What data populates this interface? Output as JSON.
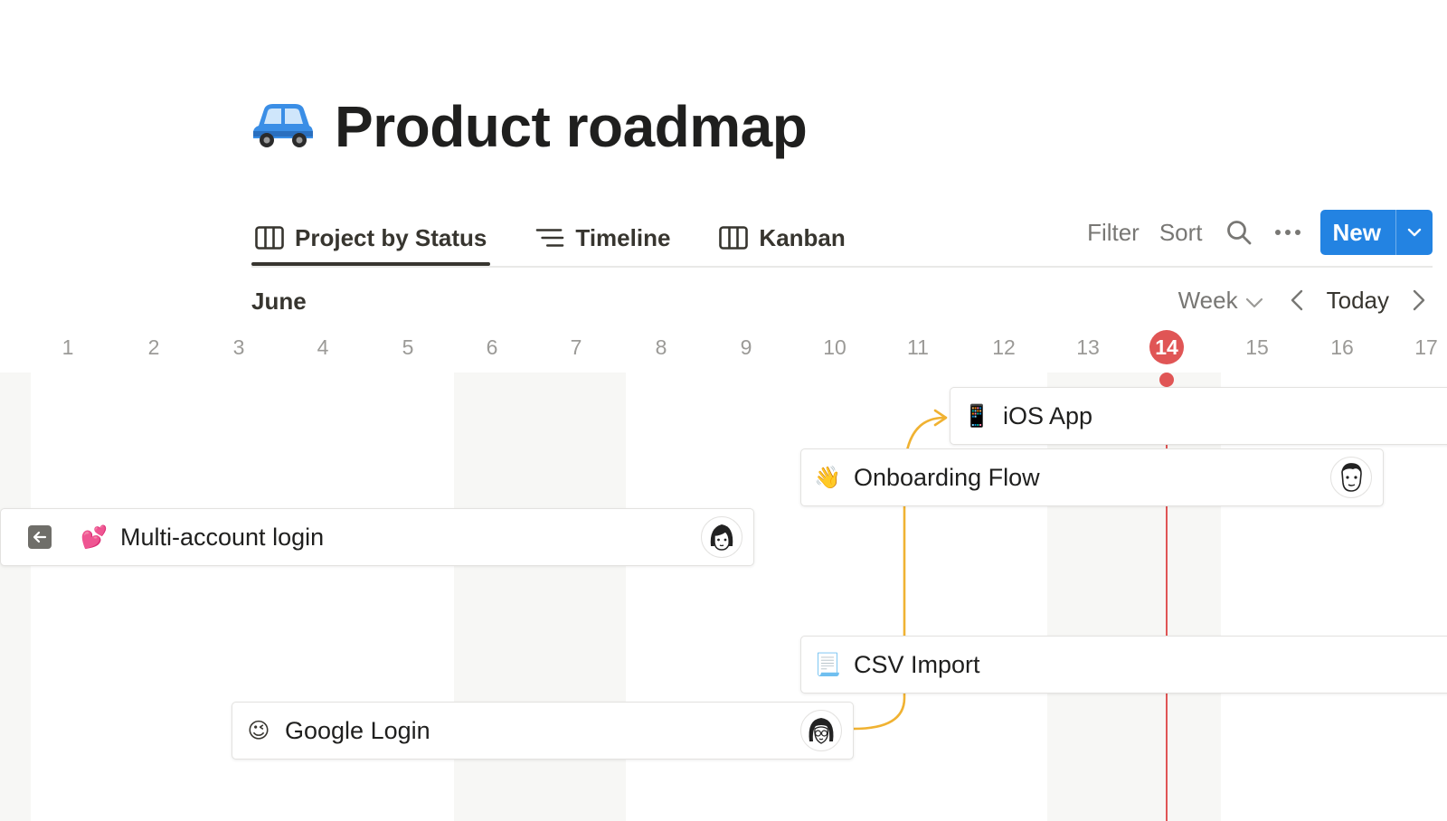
{
  "page": {
    "title": "Product roadmap",
    "icon": "car-icon"
  },
  "tabs": [
    {
      "label": "Project by Status",
      "icon": "board-icon",
      "active": true
    },
    {
      "label": "Timeline",
      "icon": "timeline-icon",
      "active": false
    },
    {
      "label": "Kanban",
      "icon": "board-icon",
      "active": false
    }
  ],
  "toolbar": {
    "filter_label": "Filter",
    "sort_label": "Sort",
    "search_icon": "search-icon",
    "more_icon": "more-icon",
    "new_label": "New",
    "new_menu_icon": "chevron-down-icon"
  },
  "timeline": {
    "month": "June",
    "scale_label": "Week",
    "today_label": "Today",
    "days": [
      "1",
      "2",
      "3",
      "4",
      "5",
      "6",
      "7",
      "8",
      "9",
      "10",
      "11",
      "12",
      "13",
      "14",
      "15",
      "16",
      "17"
    ],
    "current_day": "14"
  },
  "items": [
    {
      "emoji": "📱",
      "label": "iOS App",
      "has_avatar": false
    },
    {
      "emoji": "👋",
      "label": "Onboarding Flow",
      "has_avatar": true
    },
    {
      "emoji": "💕",
      "label": "Multi-account login",
      "has_avatar": true
    },
    {
      "emoji": "📃",
      "label": "CSV Import",
      "has_avatar": false
    },
    {
      "emoji": "😉",
      "label": "Google Login",
      "has_avatar": true
    }
  ],
  "colors": {
    "accent": "#2383e2",
    "today": "#e05555",
    "dependency": "#f0b232",
    "text": "#37352f",
    "muted": "#787774"
  }
}
